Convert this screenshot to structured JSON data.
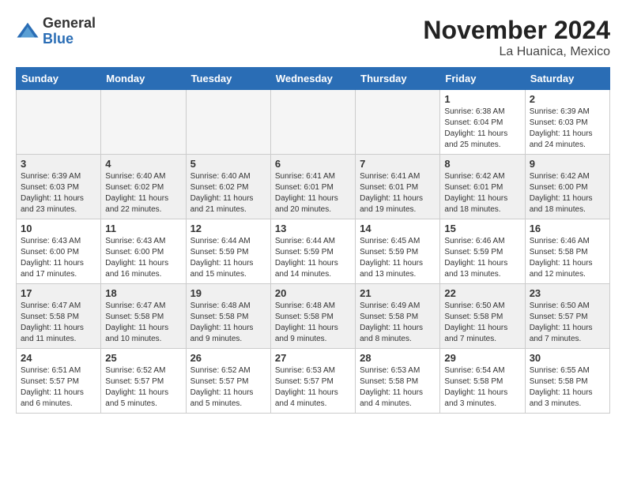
{
  "logo": {
    "general": "General",
    "blue": "Blue"
  },
  "title": "November 2024",
  "location": "La Huanica, Mexico",
  "days_of_week": [
    "Sunday",
    "Monday",
    "Tuesday",
    "Wednesday",
    "Thursday",
    "Friday",
    "Saturday"
  ],
  "weeks": [
    [
      {
        "num": "",
        "info": ""
      },
      {
        "num": "",
        "info": ""
      },
      {
        "num": "",
        "info": ""
      },
      {
        "num": "",
        "info": ""
      },
      {
        "num": "",
        "info": ""
      },
      {
        "num": "1",
        "info": "Sunrise: 6:38 AM\nSunset: 6:04 PM\nDaylight: 11 hours and 25 minutes."
      },
      {
        "num": "2",
        "info": "Sunrise: 6:39 AM\nSunset: 6:03 PM\nDaylight: 11 hours and 24 minutes."
      }
    ],
    [
      {
        "num": "3",
        "info": "Sunrise: 6:39 AM\nSunset: 6:03 PM\nDaylight: 11 hours and 23 minutes."
      },
      {
        "num": "4",
        "info": "Sunrise: 6:40 AM\nSunset: 6:02 PM\nDaylight: 11 hours and 22 minutes."
      },
      {
        "num": "5",
        "info": "Sunrise: 6:40 AM\nSunset: 6:02 PM\nDaylight: 11 hours and 21 minutes."
      },
      {
        "num": "6",
        "info": "Sunrise: 6:41 AM\nSunset: 6:01 PM\nDaylight: 11 hours and 20 minutes."
      },
      {
        "num": "7",
        "info": "Sunrise: 6:41 AM\nSunset: 6:01 PM\nDaylight: 11 hours and 19 minutes."
      },
      {
        "num": "8",
        "info": "Sunrise: 6:42 AM\nSunset: 6:01 PM\nDaylight: 11 hours and 18 minutes."
      },
      {
        "num": "9",
        "info": "Sunrise: 6:42 AM\nSunset: 6:00 PM\nDaylight: 11 hours and 18 minutes."
      }
    ],
    [
      {
        "num": "10",
        "info": "Sunrise: 6:43 AM\nSunset: 6:00 PM\nDaylight: 11 hours and 17 minutes."
      },
      {
        "num": "11",
        "info": "Sunrise: 6:43 AM\nSunset: 6:00 PM\nDaylight: 11 hours and 16 minutes."
      },
      {
        "num": "12",
        "info": "Sunrise: 6:44 AM\nSunset: 5:59 PM\nDaylight: 11 hours and 15 minutes."
      },
      {
        "num": "13",
        "info": "Sunrise: 6:44 AM\nSunset: 5:59 PM\nDaylight: 11 hours and 14 minutes."
      },
      {
        "num": "14",
        "info": "Sunrise: 6:45 AM\nSunset: 5:59 PM\nDaylight: 11 hours and 13 minutes."
      },
      {
        "num": "15",
        "info": "Sunrise: 6:46 AM\nSunset: 5:59 PM\nDaylight: 11 hours and 13 minutes."
      },
      {
        "num": "16",
        "info": "Sunrise: 6:46 AM\nSunset: 5:58 PM\nDaylight: 11 hours and 12 minutes."
      }
    ],
    [
      {
        "num": "17",
        "info": "Sunrise: 6:47 AM\nSunset: 5:58 PM\nDaylight: 11 hours and 11 minutes."
      },
      {
        "num": "18",
        "info": "Sunrise: 6:47 AM\nSunset: 5:58 PM\nDaylight: 11 hours and 10 minutes."
      },
      {
        "num": "19",
        "info": "Sunrise: 6:48 AM\nSunset: 5:58 PM\nDaylight: 11 hours and 9 minutes."
      },
      {
        "num": "20",
        "info": "Sunrise: 6:48 AM\nSunset: 5:58 PM\nDaylight: 11 hours and 9 minutes."
      },
      {
        "num": "21",
        "info": "Sunrise: 6:49 AM\nSunset: 5:58 PM\nDaylight: 11 hours and 8 minutes."
      },
      {
        "num": "22",
        "info": "Sunrise: 6:50 AM\nSunset: 5:58 PM\nDaylight: 11 hours and 7 minutes."
      },
      {
        "num": "23",
        "info": "Sunrise: 6:50 AM\nSunset: 5:57 PM\nDaylight: 11 hours and 7 minutes."
      }
    ],
    [
      {
        "num": "24",
        "info": "Sunrise: 6:51 AM\nSunset: 5:57 PM\nDaylight: 11 hours and 6 minutes."
      },
      {
        "num": "25",
        "info": "Sunrise: 6:52 AM\nSunset: 5:57 PM\nDaylight: 11 hours and 5 minutes."
      },
      {
        "num": "26",
        "info": "Sunrise: 6:52 AM\nSunset: 5:57 PM\nDaylight: 11 hours and 5 minutes."
      },
      {
        "num": "27",
        "info": "Sunrise: 6:53 AM\nSunset: 5:57 PM\nDaylight: 11 hours and 4 minutes."
      },
      {
        "num": "28",
        "info": "Sunrise: 6:53 AM\nSunset: 5:58 PM\nDaylight: 11 hours and 4 minutes."
      },
      {
        "num": "29",
        "info": "Sunrise: 6:54 AM\nSunset: 5:58 PM\nDaylight: 11 hours and 3 minutes."
      },
      {
        "num": "30",
        "info": "Sunrise: 6:55 AM\nSunset: 5:58 PM\nDaylight: 11 hours and 3 minutes."
      }
    ]
  ]
}
